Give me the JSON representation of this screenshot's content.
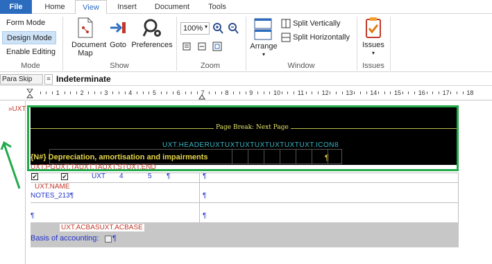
{
  "tabs": {
    "file": "File",
    "home": "Home",
    "view": "View",
    "insert": "Insert",
    "document": "Document",
    "tools": "Tools"
  },
  "ribbon": {
    "mode": {
      "form_mode": "Form Mode",
      "design_mode": "Design Mode",
      "enable_editing": "Enable Editing",
      "label": "Mode"
    },
    "show": {
      "document_map": "Document Map",
      "goto": "Goto",
      "preferences": "Preferences",
      "label": "Show"
    },
    "zoom": {
      "value": "100%",
      "label": "Zoom"
    },
    "window": {
      "arrange": "Arrange",
      "split_vertically": "Split Vertically",
      "split_horizontally": "Split Horizontally",
      "label": "Window"
    },
    "issues": {
      "issues": "Issues",
      "label": "Issues"
    }
  },
  "formula_bar": {
    "style": "Para Skip",
    "equals": "=",
    "value": "Indeterminate"
  },
  "ruler": {
    "numbers": [
      "1",
      "2",
      "3",
      "4",
      "5",
      "6",
      "7",
      "8",
      "9",
      "10",
      "11",
      "12",
      "13",
      "14",
      "15",
      "16",
      "17",
      "18"
    ]
  },
  "document": {
    "side_code": "»UXT",
    "page_break": "Page Break: Next Page",
    "header_codes": "UXT.HEADERUXTUXTUXTUXTUXTUXTUXT.ICON8",
    "heading": "{N#}  Depreciation, amortisation and impairments",
    "pilcrow": "¶",
    "row_codes": "UXT.PGUXT.TAUXT.TAUXT.STUXT.END",
    "checkbox_mark": "✔",
    "cell_uxt": "UXT",
    "cell_4": "4",
    "cell_5": "5",
    "uxt_name": "UXT.NAME",
    "notes": "NOTES_213¶",
    "acbase": "UXT.ACBASUXT.ACBASE",
    "basis": "Basis of accounting:",
    "basis_end": "¶"
  },
  "colors": {
    "accent": "#2b6cbf",
    "annotation_green": "#21a94a",
    "code_red": "#c0392b",
    "text_blue": "#2233cc",
    "header_cyan": "#38b8c8",
    "heading_yellow": "#e8d84a"
  }
}
